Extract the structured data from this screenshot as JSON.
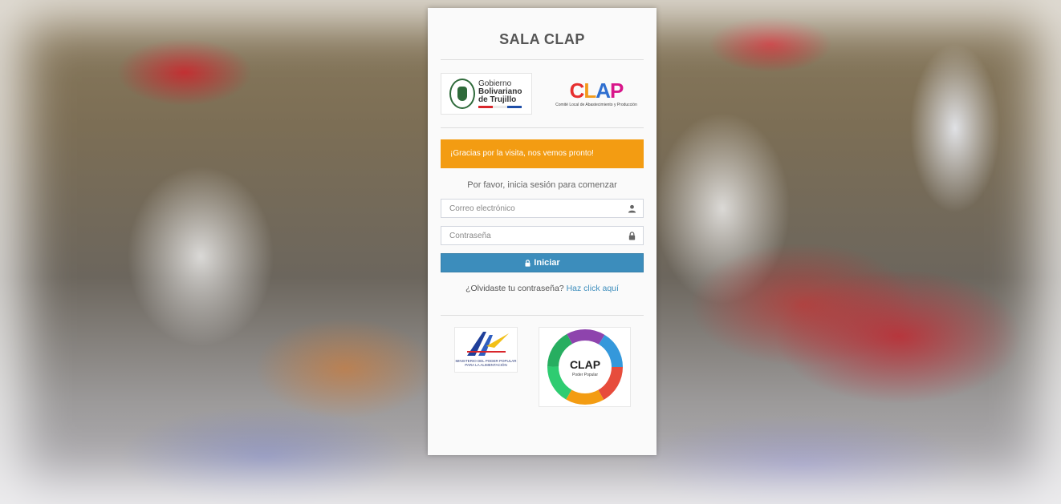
{
  "page": {
    "title": "SALA CLAP"
  },
  "logos": {
    "gobierno": {
      "line1": "Gobierno",
      "line2": "Bolivariano",
      "line3": "de Trujillo",
      "colors": [
        "#f1c40f",
        "#1f4fa8",
        "#d9262b"
      ]
    },
    "clap": {
      "letters": [
        "C",
        "L",
        "A",
        "P"
      ],
      "subtitle": "Comité Local de Abastecimiento y Producción"
    },
    "ministerio": {
      "text": "Ministerio del Poder Popular para la Alimentación"
    },
    "clap_circle": {
      "title": "CLAP",
      "subtitle": "Poder Popular"
    }
  },
  "alert": {
    "message": "¡Gracias por la visita, nos vemos pronto!",
    "color": "#f39c12"
  },
  "form": {
    "intro": "Por favor, inicia sesión para comenzar",
    "email_placeholder": "Correo electrónico",
    "email_value": "",
    "password_placeholder": "Contraseña",
    "password_value": "",
    "submit_label": "Iniciar",
    "submit_color": "#3c8dbc",
    "forgot_text": "¿Olvidaste tu contraseña?",
    "forgot_link": "Haz click aquí"
  }
}
